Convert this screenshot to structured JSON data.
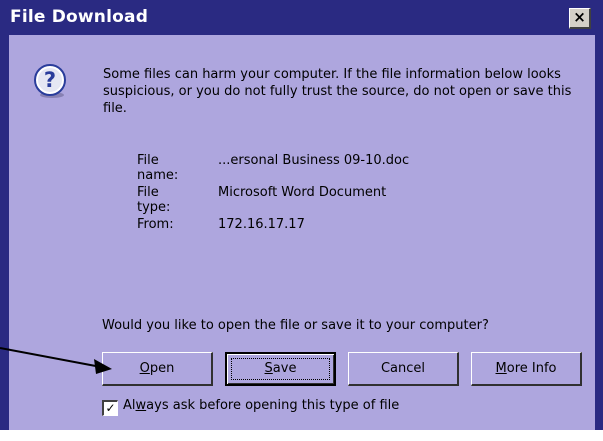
{
  "window": {
    "title": "File Download",
    "close_glyph": "×"
  },
  "icon": {
    "name": "question-icon",
    "glyph": "?"
  },
  "message": "Some files can harm your computer. If the file information below looks suspicious, or you do not fully trust the source, do not open or save this file.",
  "file_info": {
    "name_label": "File name:",
    "name_value": "...ersonal Business 09-10.doc",
    "type_label": "File type:",
    "type_value": "Microsoft Word Document",
    "from_label": "From:",
    "from_value": "172.16.17.17"
  },
  "prompt": "Would you like to open the file or save it to your computer?",
  "buttons": {
    "open": {
      "accel": "O",
      "rest": "pen"
    },
    "save": {
      "accel": "S",
      "rest": "ave"
    },
    "cancel": "Cancel",
    "more_info": {
      "accel": "M",
      "rest": "ore Info"
    }
  },
  "checkbox": {
    "checked": true,
    "check_glyph": "✓",
    "label_pre": "Al",
    "label_accel": "w",
    "label_post": "ays ask before opening this type of file"
  },
  "colors": {
    "title_bar": "#2a2a82",
    "client": "#aea6de",
    "icon_blue": "#2a3d9b"
  }
}
